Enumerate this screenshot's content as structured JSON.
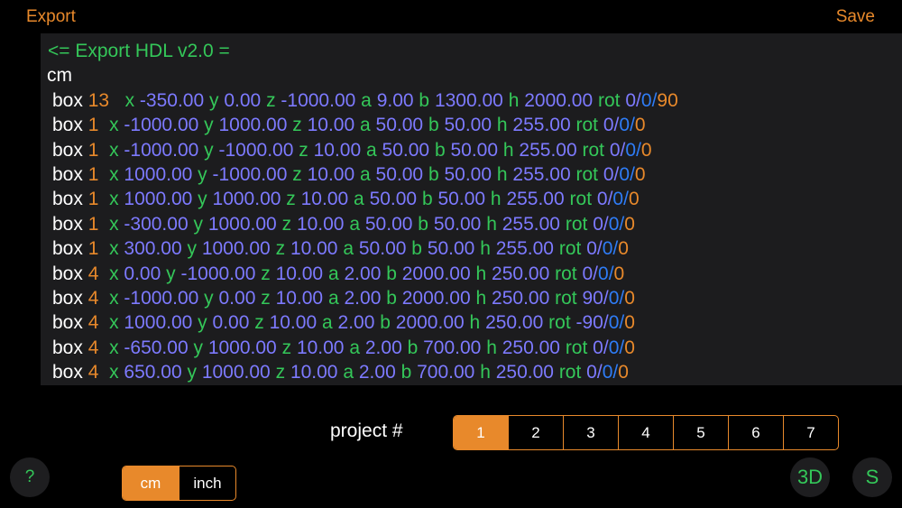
{
  "header": {
    "export_label": "Export",
    "save_label": "Save"
  },
  "code": {
    "title": "<= Export HDL v2.0 =",
    "unit": "cm",
    "lines": [
      {
        "kw": "box",
        "count": "13",
        "gap": "   ",
        "x": "-350.00",
        "y": "0.00",
        "z": "-1000.00",
        "a": "9.00",
        "b": "1300.00",
        "h": "2000.00",
        "rx": "0",
        "ry": "0",
        "rz": "90"
      },
      {
        "kw": "box",
        "count": "1",
        "gap": "  ",
        "x": "-1000.00",
        "y": "1000.00",
        "z": "10.00",
        "a": "50.00",
        "b": "50.00",
        "h": "255.00",
        "rx": "0",
        "ry": "0",
        "rz": "0"
      },
      {
        "kw": "box",
        "count": "1",
        "gap": "  ",
        "x": "-1000.00",
        "y": "-1000.00",
        "z": "10.00",
        "a": "50.00",
        "b": "50.00",
        "h": "255.00",
        "rx": "0",
        "ry": "0",
        "rz": "0"
      },
      {
        "kw": "box",
        "count": "1",
        "gap": "  ",
        "x": "1000.00",
        "y": "-1000.00",
        "z": "10.00",
        "a": "50.00",
        "b": "50.00",
        "h": "255.00",
        "rx": "0",
        "ry": "0",
        "rz": "0"
      },
      {
        "kw": "box",
        "count": "1",
        "gap": "  ",
        "x": "1000.00",
        "y": "1000.00",
        "z": "10.00",
        "a": "50.00",
        "b": "50.00",
        "h": "255.00",
        "rx": "0",
        "ry": "0",
        "rz": "0"
      },
      {
        "kw": "box",
        "count": "1",
        "gap": "  ",
        "x": "-300.00",
        "y": "1000.00",
        "z": "10.00",
        "a": "50.00",
        "b": "50.00",
        "h": "255.00",
        "rx": "0",
        "ry": "0",
        "rz": "0"
      },
      {
        "kw": "box",
        "count": "1",
        "gap": "  ",
        "x": "300.00",
        "y": "1000.00",
        "z": "10.00",
        "a": "50.00",
        "b": "50.00",
        "h": "255.00",
        "rx": "0",
        "ry": "0",
        "rz": "0"
      },
      {
        "kw": "box",
        "count": "4",
        "gap": "  ",
        "x": "0.00",
        "y": "-1000.00",
        "z": "10.00",
        "a": "2.00",
        "b": "2000.00",
        "h": "250.00",
        "rx": "0",
        "ry": "0",
        "rz": "0"
      },
      {
        "kw": "box",
        "count": "4",
        "gap": "  ",
        "x": "-1000.00",
        "y": "0.00",
        "z": "10.00",
        "a": "2.00",
        "b": "2000.00",
        "h": "250.00",
        "rx": "90",
        "ry": "0",
        "rz": "0"
      },
      {
        "kw": "box",
        "count": "4",
        "gap": "  ",
        "x": "1000.00",
        "y": "0.00",
        "z": "10.00",
        "a": "2.00",
        "b": "2000.00",
        "h": "250.00",
        "rx": "-90",
        "ry": "0",
        "rz": "0"
      },
      {
        "kw": "box",
        "count": "4",
        "gap": "  ",
        "x": "-650.00",
        "y": "1000.00",
        "z": "10.00",
        "a": "2.00",
        "b": "700.00",
        "h": "250.00",
        "rx": "0",
        "ry": "0",
        "rz": "0"
      },
      {
        "kw": "box",
        "count": "4",
        "gap": "  ",
        "x": "650.00",
        "y": "1000.00",
        "z": "10.00",
        "a": "2.00",
        "b": "700.00",
        "h": "250.00",
        "rx": "0",
        "ry": "0",
        "rz": "0"
      }
    ]
  },
  "project": {
    "label": "project #",
    "options": [
      "1",
      "2",
      "3",
      "4",
      "5",
      "6",
      "7"
    ],
    "selected": "1"
  },
  "units": {
    "options": [
      "cm",
      "inch"
    ],
    "selected": "cm"
  },
  "buttons": {
    "help": "?",
    "view3d": "3D",
    "s": "S"
  },
  "colors": {
    "accent": "#E8892B",
    "green": "#34C759",
    "value": "#7D7AFF",
    "blue": "#2E7CF6",
    "panel": "#1C1C1E"
  }
}
